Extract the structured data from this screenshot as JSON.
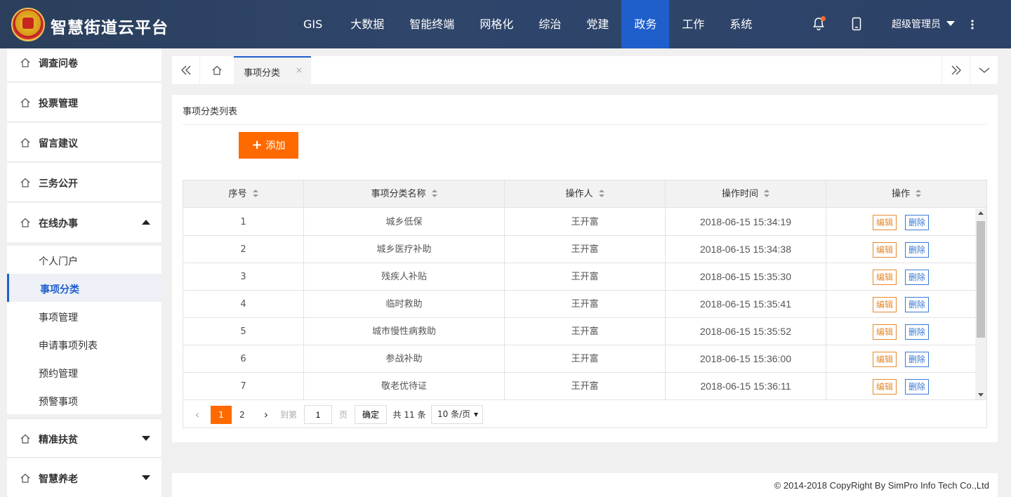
{
  "header": {
    "app_title": "智慧街道云平台",
    "logo_icon": "emblem-logo",
    "nav": [
      {
        "label": "GIS",
        "active": false
      },
      {
        "label": "大数据",
        "active": false
      },
      {
        "label": "智能终端",
        "active": false
      },
      {
        "label": "网格化",
        "active": false
      },
      {
        "label": "综治",
        "active": false
      },
      {
        "label": "党建",
        "active": false
      },
      {
        "label": "政务",
        "active": true
      },
      {
        "label": "工作",
        "active": false
      },
      {
        "label": "系统",
        "active": false
      }
    ],
    "user_label": "超级管理员",
    "accent_color": "#1f5fcc"
  },
  "sidebar": {
    "groups_top": [
      {
        "label": "调查问卷"
      },
      {
        "label": "投票管理"
      },
      {
        "label": "留言建议"
      },
      {
        "label": "三务公开"
      }
    ],
    "open_group": {
      "label": "在线办事",
      "expanded": true
    },
    "sub_items": [
      {
        "label": "个人门户",
        "active": false
      },
      {
        "label": "事项分类",
        "active": true
      },
      {
        "label": "事项管理",
        "active": false
      },
      {
        "label": "申请事项列表",
        "active": false
      },
      {
        "label": "预约管理",
        "active": false
      },
      {
        "label": "预警事项",
        "active": false
      }
    ],
    "groups_bottom": [
      {
        "label": "精准扶贫",
        "expanded": false
      },
      {
        "label": "智慧养老",
        "expanded": false
      }
    ]
  },
  "tabs": {
    "active_tab": "事项分类",
    "close_glyph": "×"
  },
  "panel": {
    "title": "事项分类列表",
    "add_button": "添加",
    "add_color": "#ff6a00"
  },
  "table": {
    "columns": [
      "序号",
      "事项分类名称",
      "操作人",
      "操作时间",
      "操作"
    ],
    "rows": [
      {
        "no": "1",
        "name": "城乡低保",
        "operator": "王开富",
        "time": "2018-06-15 15:34:19"
      },
      {
        "no": "2",
        "name": "城乡医疗补助",
        "operator": "王开富",
        "time": "2018-06-15 15:34:38"
      },
      {
        "no": "3",
        "name": "残疾人补贴",
        "operator": "王开富",
        "time": "2018-06-15 15:35:30"
      },
      {
        "no": "4",
        "name": "临时救助",
        "operator": "王开富",
        "time": "2018-06-15 15:35:41"
      },
      {
        "no": "5",
        "name": "城市慢性病救助",
        "operator": "王开富",
        "time": "2018-06-15 15:35:52"
      },
      {
        "no": "6",
        "name": "参战补助",
        "operator": "王开富",
        "time": "2018-06-15 15:36:00"
      },
      {
        "no": "7",
        "name": "敬老优待证",
        "operator": "王开富",
        "time": "2018-06-15 15:36:11"
      }
    ],
    "edit_label": "编辑",
    "delete_label": "删除"
  },
  "pager": {
    "prev": "‹",
    "pages": [
      "1",
      "2"
    ],
    "current_page": "1",
    "next": "›",
    "goto_label": "到第",
    "goto_value": "1",
    "page_unit": "页",
    "confirm": "确定",
    "total": "共 11 条",
    "page_size": "10 条/页"
  },
  "footer": {
    "copyright": "© 2014-2018 CopyRight By SimPro Info Tech Co.,Ltd"
  }
}
